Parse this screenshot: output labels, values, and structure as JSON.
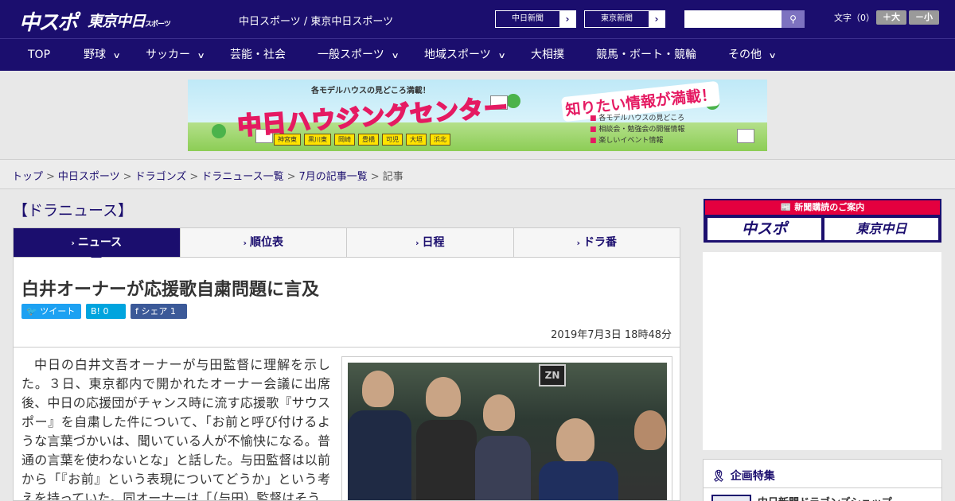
{
  "header": {
    "logo_chuspo": "中スポ",
    "logo_tokyo": "東京中日",
    "logo_tokyo_small": "スポーツ",
    "site_title": "中日スポーツ / 東京中日スポーツ",
    "paper_links": [
      "中日新聞",
      "東京新聞"
    ],
    "search_placeholder": "",
    "search_icon": "search-icon",
    "font_size_label": "文字（0）",
    "font_larger": "＋大",
    "font_smaller": "－小"
  },
  "nav": {
    "items": [
      {
        "label": "TOP",
        "dropdown": false
      },
      {
        "label": "野球",
        "dropdown": true
      },
      {
        "label": "サッカー",
        "dropdown": true
      },
      {
        "label": "芸能・社会",
        "dropdown": false
      },
      {
        "label": "一般スポーツ",
        "dropdown": true
      },
      {
        "label": "地域スポーツ",
        "dropdown": true
      },
      {
        "label": "大相撲",
        "dropdown": false
      },
      {
        "label": "競馬・ボート・競輪",
        "dropdown": false
      },
      {
        "label": "その他",
        "dropdown": true
      }
    ]
  },
  "banner": {
    "sub": "各モデルハウスの見どころ満載！",
    "main": "中日ハウジングセンター",
    "right": "知りたい情報が満載！",
    "list": [
      "各モデルハウスの見どころ",
      "相談会・勉強会の開催情報",
      "楽しいイベント情報"
    ],
    "towns": [
      "神宮東",
      "黒川東",
      "岡崎",
      "豊橋",
      "可児",
      "大垣",
      "浜北"
    ]
  },
  "breadcrumb": {
    "items": [
      "トップ",
      "中日スポーツ",
      "ドラゴンズ",
      "ドラニュース一覧",
      "7月の記事一覧"
    ],
    "current": "記事",
    "separator": ">"
  },
  "main": {
    "section_title": "【ドラニュース】",
    "tabs": [
      {
        "label": "ニュース",
        "active": true
      },
      {
        "label": "順位表",
        "active": false
      },
      {
        "label": "日程",
        "active": false
      },
      {
        "label": "ドラ番",
        "active": false
      }
    ],
    "headline": "白井オーナーが応援歌自粛問題に言及",
    "share": {
      "tweet": "ツイート",
      "hatena": "B! 0",
      "facebook": "シェア 1"
    },
    "date": "2019年7月3日 18時48分",
    "body": "中日の白井文吾オーナーが与田監督に理解を示した。３日、東京都内で開かれたオーナー会議に出席後、中日の応援団がチャンス時に流す応援歌『サウスポー』を自粛した件について、「お前と呼び付けるような言葉づかいは、聞いている人が不愉快になる。普通の言葉を使わないとな」と話した。与田監督は以前から「『お前』という表現についてどうか」という考えを持っていた。同オーナーは「（与田）監督はそう",
    "photo_sign": "ZN"
  },
  "sidebar": {
    "subscribe_title": "新聞購読のご案内",
    "subscribe_logos": [
      "中スポ",
      "東京中日"
    ],
    "feature_title": "企画特集",
    "feature_item": "中日新聞ドラゴンズショップ"
  },
  "colors": {
    "brand": "#1b0e6e",
    "accent_red": "#e4003f",
    "twitter": "#1da1f2",
    "hatena": "#00a4de",
    "facebook": "#3b5998"
  }
}
